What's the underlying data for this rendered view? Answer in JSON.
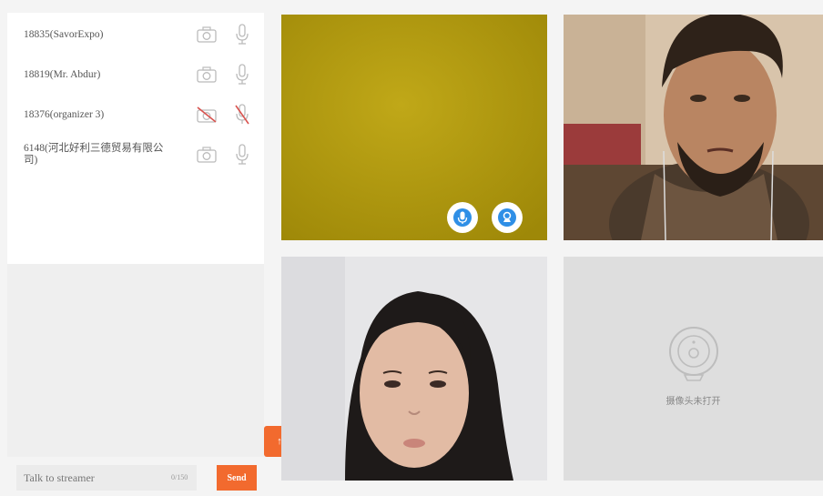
{
  "participants": [
    {
      "name": "18835(SavorExpo)",
      "muted": false
    },
    {
      "name": "18819(Mr. Abdur)",
      "muted": false
    },
    {
      "name": "18376(organizer 3)",
      "muted": true
    },
    {
      "name": "6148(河北好利三德贸易有限公司)",
      "muted": false
    }
  ],
  "chat": {
    "placeholder": "Talk to streamer",
    "counter": "0/150",
    "send_label": "Send"
  },
  "toggle_label": "↑",
  "tiles": [
    {
      "kind": "video",
      "controls": [
        "mic-on",
        "camera-on"
      ]
    },
    {
      "kind": "video"
    },
    {
      "kind": "video"
    },
    {
      "kind": "camera-off",
      "label": "摄像头未打开"
    }
  ],
  "colors": {
    "accent": "#f26a2e",
    "ctrl_blue": "#2f8fe6",
    "tile_yellow": "#b49d12"
  }
}
